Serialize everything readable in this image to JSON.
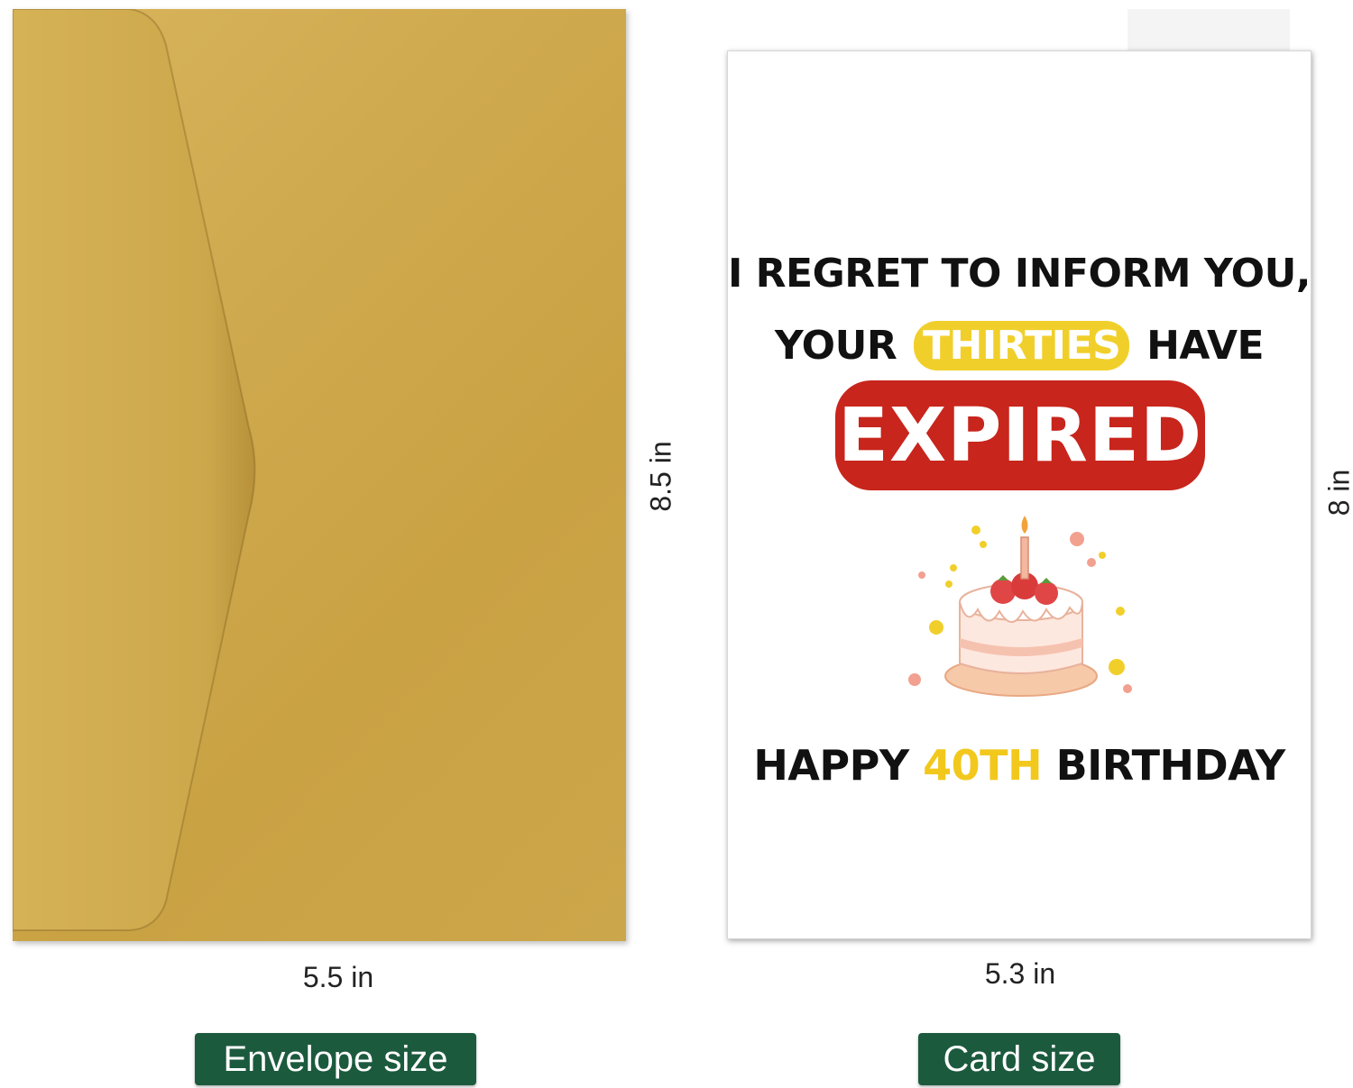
{
  "envelope": {
    "width_label": "5.5 in",
    "height_label": "8.5 in",
    "caption": "Envelope size",
    "color": "#cfa94d"
  },
  "card": {
    "line1": "I REGRET TO INFORM YOU,",
    "line2_before": "YOUR",
    "line2_highlight": "THIRTIES",
    "line2_after": "HAVE",
    "expired": "EXPIRED",
    "line3_before": "HAPPY",
    "line3_highlight": "40TH",
    "line3_after": "BIRTHDAY",
    "width_label": "5.3 in",
    "height_label": "8 in",
    "caption": "Card size",
    "accent_red": "#c8251c",
    "accent_yellow": "#f1cf2b"
  },
  "caption_color": "#1c5a3e"
}
